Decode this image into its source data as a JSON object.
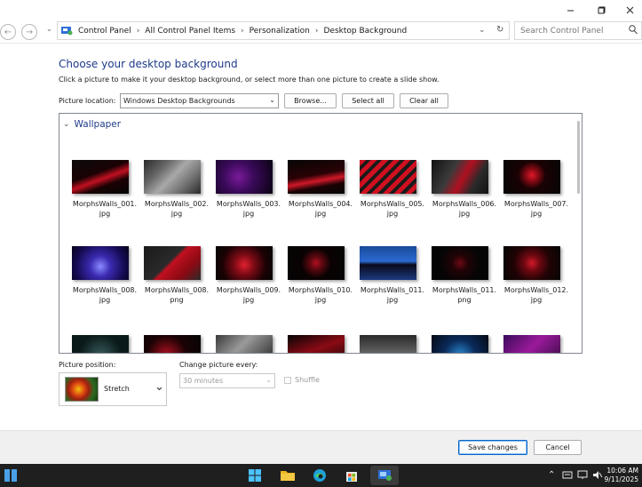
{
  "window": {
    "min_icon": "minimize-icon",
    "max_icon": "maximize-icon",
    "close_icon": "close-icon"
  },
  "address": {
    "breadcrumbs": [
      "Control Panel",
      "All Control Panel Items",
      "Personalization",
      "Desktop Background"
    ],
    "search_placeholder": "Search Control Panel"
  },
  "page": {
    "title": "Choose your desktop background",
    "subtitle": "Click a picture to make it your desktop background, or select more than one picture to create a slide show.",
    "picture_location_label": "Picture location:",
    "picture_location_value": "Windows Desktop Backgrounds",
    "browse_label": "Browse...",
    "select_all_label": "Select all",
    "clear_all_label": "Clear all"
  },
  "gallery": {
    "group_name": "Wallpaper",
    "items": [
      {
        "cap1": "MorphsWalls_001.",
        "cap2": "jpg"
      },
      {
        "cap1": "MorphsWalls_002.",
        "cap2": "jpg"
      },
      {
        "cap1": "MorphsWalls_003.",
        "cap2": "jpg"
      },
      {
        "cap1": "MorphsWalls_004.",
        "cap2": "jpg"
      },
      {
        "cap1": "MorphsWalls_005.",
        "cap2": "jpg"
      },
      {
        "cap1": "MorphsWalls_006.",
        "cap2": "jpg"
      },
      {
        "cap1": "MorphsWalls_007.",
        "cap2": "jpg"
      },
      {
        "cap1": "MorphsWalls_008.",
        "cap2": "jpg"
      },
      {
        "cap1": "MorphsWalls_008.",
        "cap2": "png"
      },
      {
        "cap1": "MorphsWalls_009.",
        "cap2": "jpg"
      },
      {
        "cap1": "MorphsWalls_010.",
        "cap2": "jpg"
      },
      {
        "cap1": "MorphsWalls_011.",
        "cap2": "jpg"
      },
      {
        "cap1": "MorphsWalls_011.",
        "cap2": "png"
      },
      {
        "cap1": "MorphsWalls_012.",
        "cap2": "jpg"
      }
    ]
  },
  "options": {
    "position_label": "Picture position:",
    "position_value": "Stretch",
    "change_every_label": "Change picture every:",
    "change_every_value": "30 minutes",
    "shuffle_label": "Shuffle"
  },
  "footer": {
    "save_label": "Save changes",
    "cancel_label": "Cancel"
  },
  "taskbar": {
    "time": "10:06 AM",
    "date": "9/11/2025"
  },
  "colors": {
    "title_blue": "#1e3a8a",
    "taskbar_bg": "#1f1f1f"
  }
}
